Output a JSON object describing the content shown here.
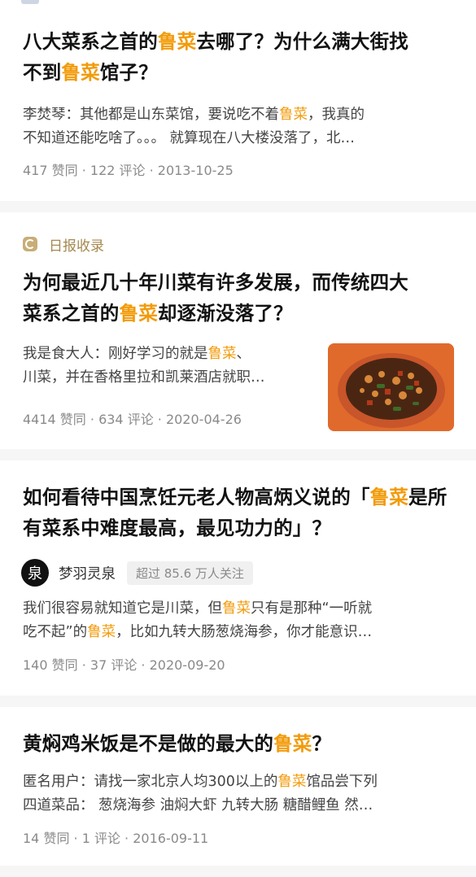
{
  "cards": [
    {
      "title_parts": [
        "八大菜系之首的",
        "鲁菜",
        "去哪了？为什么满大街找",
        "不到",
        "鲁菜",
        "馆子？"
      ],
      "excerpt_parts": [
        "李焚琴：其他都是山东菜馆，要说吃不着",
        "鲁菜",
        "，我真的",
        "不知道还能吃啥了。。。 就算现在八大楼没落了，北…"
      ],
      "meta": "417 赞同 · 122 评论 · 2013-10-25"
    },
    {
      "badge": "日报收录",
      "title_parts": [
        "为何最近几十年川菜有许多发展，而传统四大",
        "菜系之首的",
        "鲁菜",
        "却逐渐没落了？"
      ],
      "excerpt_parts": [
        "我是食大人：刚好学习的就是",
        "鲁菜",
        "、",
        "川菜，并在香格里拉和凯莱酒店就职…"
      ],
      "meta": "4414 赞同 · 634 评论 · 2020-04-26"
    },
    {
      "title_parts": [
        "如何看待中国烹饪元老人物高炳义说的「",
        "鲁菜",
        "是所有菜系中难度最高，最见功力的」？"
      ],
      "author": {
        "avatar_char": "泉",
        "name": "梦羽灵泉",
        "follow_badge": "超过 85.6 万人关注"
      },
      "excerpt_parts": [
        "我们很容易就知道它是川菜，但",
        "鲁菜",
        "只有是那种“一听就",
        "吃不起”的",
        "鲁菜",
        "，比如九转大肠葱烧海参，你才能意识…"
      ],
      "meta": "140 赞同 · 37 评论 · 2020-09-20"
    },
    {
      "title_parts": [
        "黄焖鸡米饭是不是做的最大的",
        "鲁菜",
        "？"
      ],
      "excerpt_parts": [
        "匿名用户：请找一家北京人均300以上的",
        "鲁菜",
        "馆品尝下列",
        "四道菜品： 葱烧海参 油焖大虾 九转大肠 糖醋鲤鱼 然…"
      ],
      "meta": "14 赞同 · 1 评论 · 2016-09-11"
    }
  ],
  "colors": {
    "highlight": "#f29b0a",
    "badge": "#a6884e"
  }
}
